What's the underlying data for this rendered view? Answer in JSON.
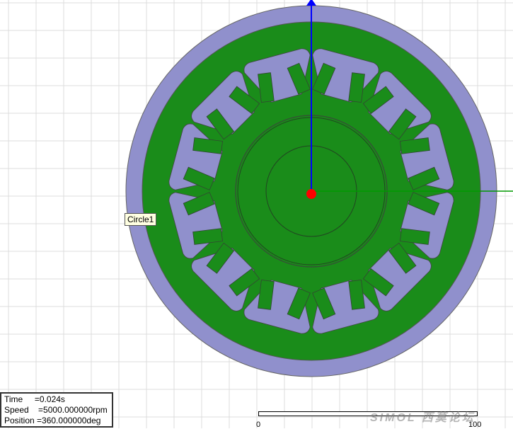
{
  "tooltip": {
    "text": "Circle1"
  },
  "info": {
    "time": "Time     =0.024s",
    "speed": "Speed    =5000.000000rpm",
    "position": "Position =360.000000deg"
  },
  "scale": {
    "min_label": "0",
    "max_label": "100"
  },
  "watermark": {
    "text": "SIMOL 西莫论坛"
  },
  "colors": {
    "grid": "#dcdcdc",
    "air": "#9090cc",
    "iron": "#1a8c1a",
    "axis_y": "#0000ff",
    "axis_x": "#009900",
    "origin": "#ff0000"
  },
  "geometry_counts": {
    "slots": 12
  }
}
